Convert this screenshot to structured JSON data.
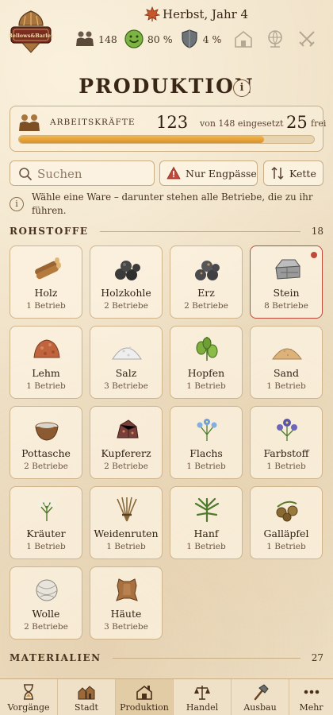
{
  "header": {
    "logo_text": "Bellows & Barley",
    "season": "Herbst, Jahr 4",
    "population": "148",
    "happiness": "80 %",
    "defense": "4 %",
    "icons": [
      "population-icon",
      "happy-face-icon",
      "shield-icon",
      "building-icon",
      "globe-icon",
      "crossed-swords-icon"
    ]
  },
  "page": {
    "title": "PRODUKTION",
    "info": "i"
  },
  "workforce": {
    "label": "ARBEITSKRÄFTE",
    "used": "123",
    "of_text": "von 148 eingesetzt",
    "free": "25",
    "free_label": "frei",
    "used_fraction": 0.831,
    "bar_color": "#e3a23a"
  },
  "toolbar": {
    "search_placeholder": "Suchen",
    "engpass_label": "Nur Engpässe",
    "kette_label": "Kette"
  },
  "hint": {
    "icon": "i",
    "text": "Wähle eine Ware – darunter stehen alle Betriebe, die zu ihr führen."
  },
  "sections": {
    "rohstoffe": {
      "title": "ROHSTOFFE",
      "count": "18"
    },
    "materialien": {
      "title": "MATERIALIEN",
      "count": "27"
    }
  },
  "goods": [
    {
      "name": "Holz",
      "sub": "1 Betrieb",
      "icon": "wood-logs-icon"
    },
    {
      "name": "Holzkohle",
      "sub": "2 Betriebe",
      "icon": "charcoal-icon"
    },
    {
      "name": "Erz",
      "sub": "2 Betriebe",
      "icon": "ore-icon"
    },
    {
      "name": "Stein",
      "sub": "8 Betriebe",
      "icon": "stone-icon",
      "selected": true
    },
    {
      "name": "Lehm",
      "sub": "1 Betrieb",
      "icon": "clay-icon"
    },
    {
      "name": "Salz",
      "sub": "3 Betriebe",
      "icon": "salt-icon"
    },
    {
      "name": "Hopfen",
      "sub": "1 Betrieb",
      "icon": "hops-icon"
    },
    {
      "name": "Sand",
      "sub": "1 Betrieb",
      "icon": "sand-icon"
    },
    {
      "name": "Pottasche",
      "sub": "2 Betriebe",
      "icon": "potash-icon"
    },
    {
      "name": "Kupfererz",
      "sub": "2 Betriebe",
      "icon": "copper-ore-icon"
    },
    {
      "name": "Flachs",
      "sub": "1 Betrieb",
      "icon": "flax-icon"
    },
    {
      "name": "Farbstoff",
      "sub": "1 Betrieb",
      "icon": "dye-flower-icon"
    },
    {
      "name": "Kräuter",
      "sub": "1 Betrieb",
      "icon": "herbs-icon"
    },
    {
      "name": "Weidenruten",
      "sub": "1 Betrieb",
      "icon": "willow-rods-icon"
    },
    {
      "name": "Hanf",
      "sub": "1 Betrieb",
      "icon": "hemp-icon"
    },
    {
      "name": "Galläpfel",
      "sub": "1 Betrieb",
      "icon": "gall-apples-icon"
    },
    {
      "name": "Wolle",
      "sub": "2 Betriebe",
      "icon": "wool-icon"
    },
    {
      "name": "Häute",
      "sub": "3 Betriebe",
      "icon": "hide-icon"
    }
  ],
  "nav": [
    {
      "label": "Vorgänge",
      "icon": "hourglass-icon"
    },
    {
      "label": "Stadt",
      "icon": "town-icon"
    },
    {
      "label": "Produktion",
      "icon": "production-icon",
      "active": true
    },
    {
      "label": "Handel",
      "icon": "trade-scale-icon"
    },
    {
      "label": "Ausbau",
      "icon": "hammer-icon"
    },
    {
      "label": "Mehr",
      "icon": "more-dots-icon"
    }
  ]
}
